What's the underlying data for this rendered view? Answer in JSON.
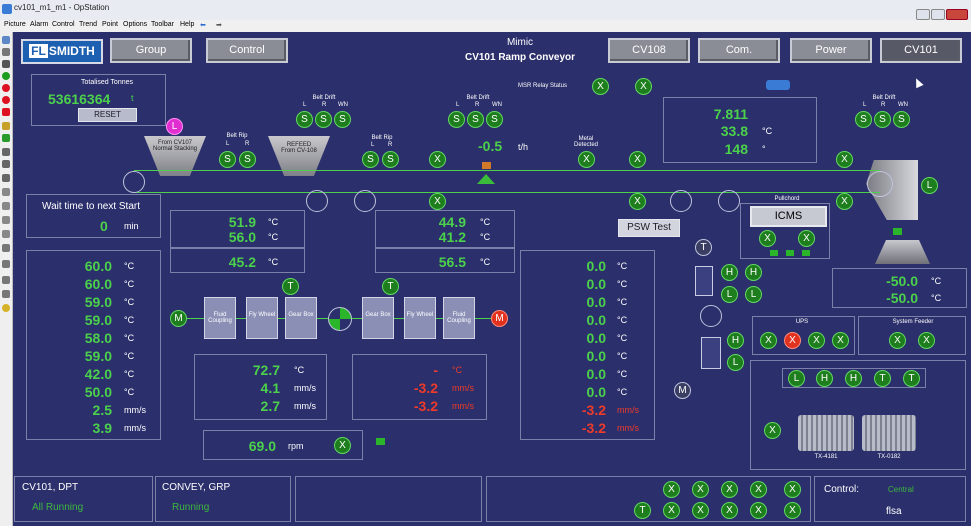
{
  "window": {
    "title": "cv101_m1_m1 - OpStation"
  },
  "menu": [
    "Picture",
    "Alarm",
    "Control",
    "Trend",
    "Point",
    "Options",
    "Toolbar",
    "Help"
  ],
  "logo": "FLSMIDTH",
  "header": {
    "group": "Group",
    "control": "Control",
    "mimic": "Mimic",
    "screen_title": "CV101 Ramp Conveyor",
    "cv108": "CV108",
    "com": "Com.",
    "power": "Power",
    "cv101": "CV101"
  },
  "totalised": {
    "label": "Totalised Tonnes",
    "value": "53616364",
    "unit": "t",
    "reset": "RESET"
  },
  "wait": {
    "label": "Wait time to next Start",
    "value": "0",
    "unit": "min"
  },
  "labels": {
    "belt_drift": "Belt Drift",
    "belt_rip": "Belt Rip",
    "l": "L",
    "r": "R",
    "wn": "WN",
    "s": "S",
    "msr": "MSR Relay Status",
    "metal": "Metal Detected",
    "pullchord": "Pullchord",
    "icms": "ICMS",
    "psw": "PSW Test",
    "ups": "UPS",
    "system_feeder": "System Feeder",
    "from_cv107": "From CV107 Normal Stacking",
    "refeed": "REFEED From CV-108",
    "fluid": "Fluid Coupling",
    "fly": "Fly Wheel",
    "gear": "Gear Box",
    "tx1": "TX-4181",
    "tx2": "TX-0182",
    "x": "X",
    "t": "T",
    "m": "M",
    "h": "H",
    "l_mark": "L",
    "lmag": "L"
  },
  "flow": {
    "value": "-0.5",
    "unit": "t/h"
  },
  "top_right_vals": [
    {
      "v": "7.811",
      "u": ""
    },
    {
      "v": "33.8",
      "u": "°C"
    },
    {
      "v": "148",
      "u": "°"
    }
  ],
  "left_motor_temps": [
    {
      "v": "51.9",
      "u": "°C"
    },
    {
      "v": "56.0",
      "u": "°C"
    }
  ],
  "left_motor_temp3": {
    "v": "45.2",
    "u": "°C"
  },
  "right_motor_temps": [
    {
      "v": "44.9",
      "u": "°C"
    },
    {
      "v": "41.2",
      "u": "°C"
    }
  ],
  "right_motor_temp3": {
    "v": "56.5",
    "u": "°C"
  },
  "left_list": [
    {
      "v": "60.0",
      "u": "°C"
    },
    {
      "v": "60.0",
      "u": "°C"
    },
    {
      "v": "59.0",
      "u": "°C"
    },
    {
      "v": "59.0",
      "u": "°C"
    },
    {
      "v": "58.0",
      "u": "°C"
    },
    {
      "v": "59.0",
      "u": "°C"
    },
    {
      "v": "42.0",
      "u": "°C"
    },
    {
      "v": "50.0",
      "u": "°C"
    },
    {
      "v": "2.5",
      "u": "mm/s"
    },
    {
      "v": "3.9",
      "u": "mm/s"
    }
  ],
  "right_list": [
    {
      "v": "0.0",
      "u": "°C",
      "c": "green"
    },
    {
      "v": "0.0",
      "u": "°C",
      "c": "green"
    },
    {
      "v": "0.0",
      "u": "°C",
      "c": "green"
    },
    {
      "v": "0.0",
      "u": "°C",
      "c": "green"
    },
    {
      "v": "0.0",
      "u": "°C",
      "c": "green"
    },
    {
      "v": "0.0",
      "u": "°C",
      "c": "green"
    },
    {
      "v": "0.0",
      "u": "°C",
      "c": "green"
    },
    {
      "v": "0.0",
      "u": "°C",
      "c": "green"
    },
    {
      "v": "-3.2",
      "u": "mm/s",
      "c": "red"
    },
    {
      "v": "-3.2",
      "u": "mm/s",
      "c": "red"
    }
  ],
  "gear_left": [
    {
      "v": "72.7",
      "u": "°C"
    },
    {
      "v": "4.1",
      "u": "mm/s"
    },
    {
      "v": "2.7",
      "u": "mm/s"
    }
  ],
  "gear_right": [
    {
      "v": "-",
      "u": "°C"
    },
    {
      "v": "-3.2",
      "u": "mm/s"
    },
    {
      "v": "-3.2",
      "u": "mm/s"
    }
  ],
  "rpm": {
    "v": "69.0",
    "u": "rpm"
  },
  "pulley_temps": [
    {
      "v": "-50.0",
      "u": "°C"
    },
    {
      "v": "-50.0",
      "u": "°C"
    }
  ],
  "status": {
    "dpt_label": "CV101, DPT",
    "dpt_value": "All Running",
    "grp_label": "CONVEY, GRP",
    "grp_value": "Running",
    "control_label": "Control:",
    "control_value": "Central",
    "user": "flsa"
  }
}
